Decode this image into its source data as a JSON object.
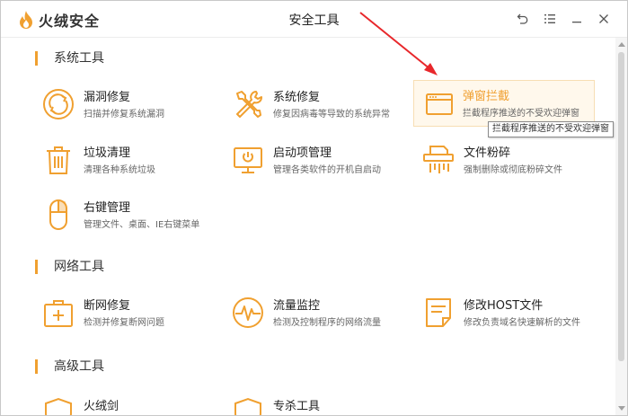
{
  "app": {
    "name": "火绒安全",
    "window_title": "安全工具"
  },
  "colors": {
    "accent": "#f0a030",
    "arrow": "#e8272b"
  },
  "sections": [
    {
      "title": "系统工具",
      "tools": [
        {
          "icon": "vulnerability-repair-icon",
          "name": "漏洞修复",
          "desc": "扫描并修复系统漏洞"
        },
        {
          "icon": "system-repair-icon",
          "name": "系统修复",
          "desc": "修复因病毒等导致的系统异常"
        },
        {
          "icon": "popup-block-icon",
          "name": "弹窗拦截",
          "desc": "拦截程序推送的不受欢迎弹窗"
        },
        {
          "icon": "trash-icon",
          "name": "垃圾清理",
          "desc": "清理各种系统垃圾"
        },
        {
          "icon": "startup-icon",
          "name": "启动项管理",
          "desc": "管理各类软件的开机自启动"
        },
        {
          "icon": "shredder-icon",
          "name": "文件粉碎",
          "desc": "强制删除或彻底粉碎文件"
        },
        {
          "icon": "mouse-icon",
          "name": "右键管理",
          "desc": "管理文件、桌面、IE右键菜单"
        }
      ]
    },
    {
      "title": "网络工具",
      "tools": [
        {
          "icon": "network-repair-icon",
          "name": "断网修复",
          "desc": "检测并修复断网问题"
        },
        {
          "icon": "traffic-monitor-icon",
          "name": "流量监控",
          "desc": "检测及控制程序的网络流量"
        },
        {
          "icon": "host-file-icon",
          "name": "修改HOST文件",
          "desc": "修改负责域名快速解析的文件"
        }
      ]
    },
    {
      "title": "高级工具",
      "tools": [
        {
          "icon": "sword-icon",
          "name": "火绒剑"
        },
        {
          "icon": "specialist-icon",
          "name": "专杀工具"
        }
      ]
    }
  ],
  "tooltip": "拦截程序推送的不受欢迎弹窗"
}
